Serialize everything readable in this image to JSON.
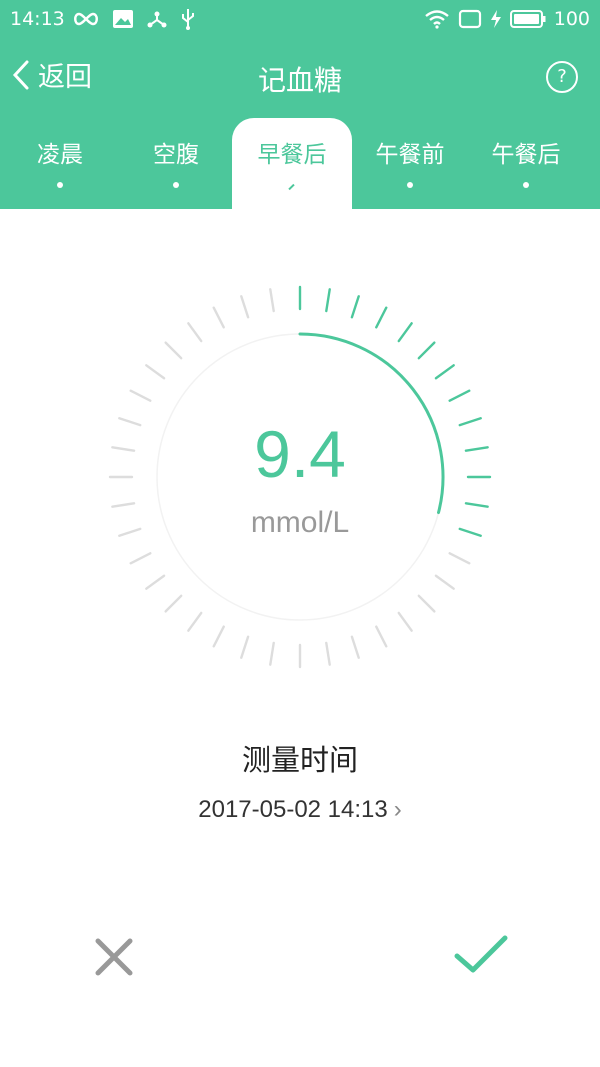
{
  "status_bar": {
    "time": "14:13",
    "battery": "100",
    "icons": [
      "infinity-icon",
      "image-icon",
      "share-icon",
      "usb-icon",
      "wifi-icon",
      "screen-icon",
      "charging-icon",
      "battery-icon"
    ]
  },
  "nav": {
    "back_label": "返回",
    "title": "记血糖",
    "help": "?"
  },
  "tabs": [
    "凌晨",
    "空腹",
    "早餐后",
    "午餐前",
    "午餐后"
  ],
  "active_tab": "早餐后",
  "reading": {
    "value": "9.4",
    "unit": "mmol/L",
    "gauge_fill_fraction": 0.29
  },
  "measure": {
    "title": "测量时间",
    "datetime": "2017-05-02 14:13",
    "arrow": "›"
  },
  "colors": {
    "accent": "#4cc79b",
    "tick_inactive": "#dddddd",
    "cancel": "#999999"
  }
}
